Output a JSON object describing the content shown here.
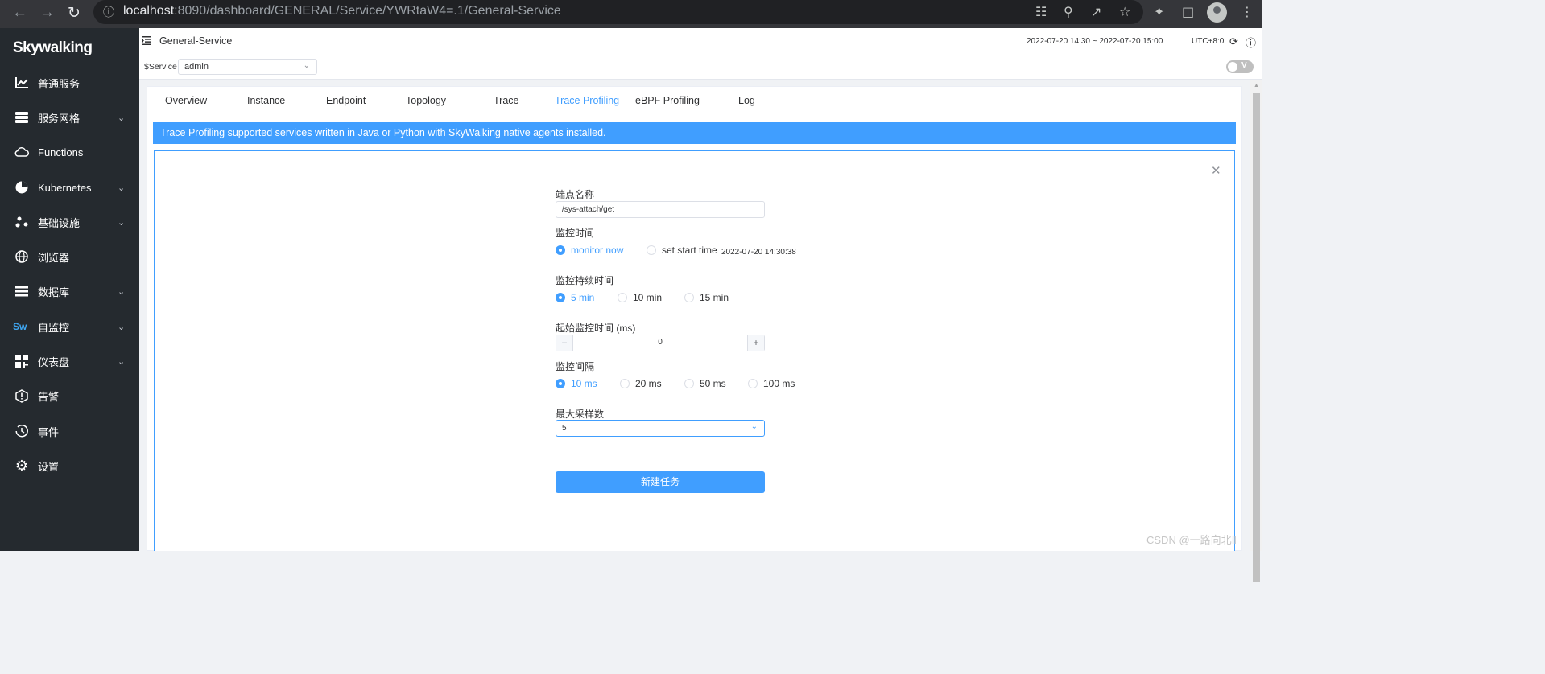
{
  "browser": {
    "url_host": "localhost",
    "url_rest": ":8090/dashboard/GENERAL/Service/YWRtaW4=.1/General-Service"
  },
  "sidebar": {
    "logo": "Skywalking",
    "items": [
      {
        "label": "普通服务",
        "icon": "bar-chart-icon",
        "expandable": false
      },
      {
        "label": "服务网格",
        "icon": "layers-icon",
        "expandable": true
      },
      {
        "label": "Functions",
        "icon": "cloud-icon",
        "expandable": false
      },
      {
        "label": "Kubernetes",
        "icon": "pie-icon",
        "expandable": true
      },
      {
        "label": "基础设施",
        "icon": "nodes-icon",
        "expandable": true
      },
      {
        "label": "浏览器",
        "icon": "globe-icon",
        "expandable": false
      },
      {
        "label": "数据库",
        "icon": "database-icon",
        "expandable": true
      },
      {
        "label": "自监控",
        "icon": "sw-icon",
        "expandable": true
      },
      {
        "label": "仪表盘",
        "icon": "dashboard-icon",
        "expandable": true
      },
      {
        "label": "告警",
        "icon": "alarm-icon",
        "expandable": false
      },
      {
        "label": "事件",
        "icon": "event-icon",
        "expandable": false
      },
      {
        "label": "设置",
        "icon": "gear-icon",
        "expandable": false
      }
    ],
    "sw_glyph": "Sw"
  },
  "header": {
    "title": "General-Service",
    "time_range": "2022-07-20 14:30 ~ 2022-07-20 15:00",
    "timezone": "UTC+8:0"
  },
  "selector": {
    "label": "$Service",
    "value": "admin",
    "toggle_label": "V"
  },
  "tabs": [
    {
      "label": "Overview",
      "active": false
    },
    {
      "label": "Instance",
      "active": false
    },
    {
      "label": "Endpoint",
      "active": false
    },
    {
      "label": "Topology",
      "active": false
    },
    {
      "label": "Trace",
      "active": false
    },
    {
      "label": "Trace Profiling",
      "active": true
    },
    {
      "label": "eBPF Profiling",
      "active": false
    },
    {
      "label": "Log",
      "active": false
    }
  ],
  "banner": "Trace Profiling supported services written in Java or Python with SkyWalking native agents installed.",
  "form": {
    "endpoint_label": "端点名称",
    "endpoint_value": "/sys-attach/get",
    "monitor_time_label": "监控时间",
    "monitor_now": "monitor now",
    "set_start_time": "set start time",
    "start_time_value": "2022-07-20 14:30:38",
    "duration_label": "监控持续时间",
    "duration_options": [
      "5 min",
      "10 min",
      "15 min"
    ],
    "duration_selected": "5 min",
    "min_duration_label": "起始监控时间 (ms)",
    "min_duration_value": "0",
    "interval_label": "监控间隔",
    "interval_options": [
      "10 ms",
      "20 ms",
      "50 ms",
      "100 ms"
    ],
    "interval_selected": "10 ms",
    "max_samples_label": "最大采样数",
    "max_samples_value": "5",
    "submit_label": "新建任务"
  },
  "watermark": "CSDN @一路向北Ⅱ",
  "colors": {
    "primary": "#409eff",
    "sidebar_bg": "#252a2f",
    "chrome_bg": "#35363a"
  }
}
